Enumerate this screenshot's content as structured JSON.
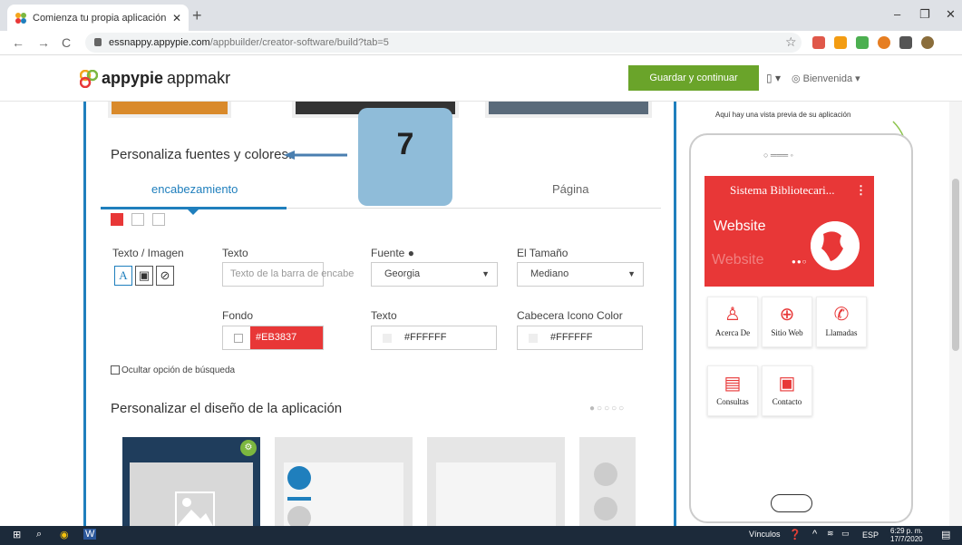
{
  "browser": {
    "tab_title": "Comienza tu propia aplicación en",
    "tab_close": "✕",
    "new_tab": "+",
    "minimize": "–",
    "restore": "❐",
    "close": "✕",
    "url_host": "essnappy.appypie.com",
    "url_path": "/appbuilder/creator-software/build?tab=5",
    "back": "←",
    "forward": "→",
    "reload": "C",
    "star": "☆"
  },
  "app": {
    "logo_brand": "appypie",
    "logo_product": "appmakr",
    "save_button": "Guardar y continuar",
    "device_icon": "▯ ▾",
    "welcome": "Bienvenida ▾"
  },
  "editor": {
    "section_title": "Personaliza fuentes y colores.",
    "tip_number": "7",
    "tabs": [
      {
        "label": "encabezamiento",
        "active": true
      },
      {
        "label": "Página",
        "active": false
      }
    ],
    "swatch_colors": [
      "#e83737",
      "#ffffff",
      "#ffffff"
    ],
    "labels": {
      "text_image": "Texto / Imagen",
      "text": "Texto",
      "font": "Fuente",
      "size": "El Tamaño",
      "background": "Fondo",
      "text_color": "Texto",
      "header_icon_color": "Cabecera Icono Color"
    },
    "text_placeholder": "Texto de la barra de encabe",
    "font_value": "Georgia",
    "size_value": "Mediano",
    "background_color": "#EB3837",
    "text_color_value": "#FFFFFF",
    "header_icon_color_value": "#FFFFFF",
    "hide_search": "Ocultar opción de búsqueda",
    "design_title": "Personalizar el diseño de la aplicación",
    "pager_dots": "●○○○○"
  },
  "preview": {
    "hint": "Aquí hay una vista previa de su aplicación",
    "app_title": "Sistema Bibliotecari...",
    "menu_icon": "⋮",
    "banner_text": "Website",
    "banner_text_faded": "Website",
    "banner_dots": "●●○",
    "buttons": [
      {
        "label": "Acerca De",
        "icon": "person-icon",
        "glyph": "♙"
      },
      {
        "label": "Sitio Web",
        "icon": "globe-icon",
        "glyph": "⊕"
      },
      {
        "label": "Llamadas",
        "icon": "phone-icon",
        "glyph": "✆"
      },
      {
        "label": "Consultas",
        "icon": "document-icon",
        "glyph": "▤"
      },
      {
        "label": "Contacto",
        "icon": "contact-card-icon",
        "glyph": "▣"
      }
    ]
  },
  "taskbar": {
    "links_label": "Vínculos",
    "lang": "ESP",
    "time": "6:29 p. m.",
    "date": "17/7/2020"
  }
}
